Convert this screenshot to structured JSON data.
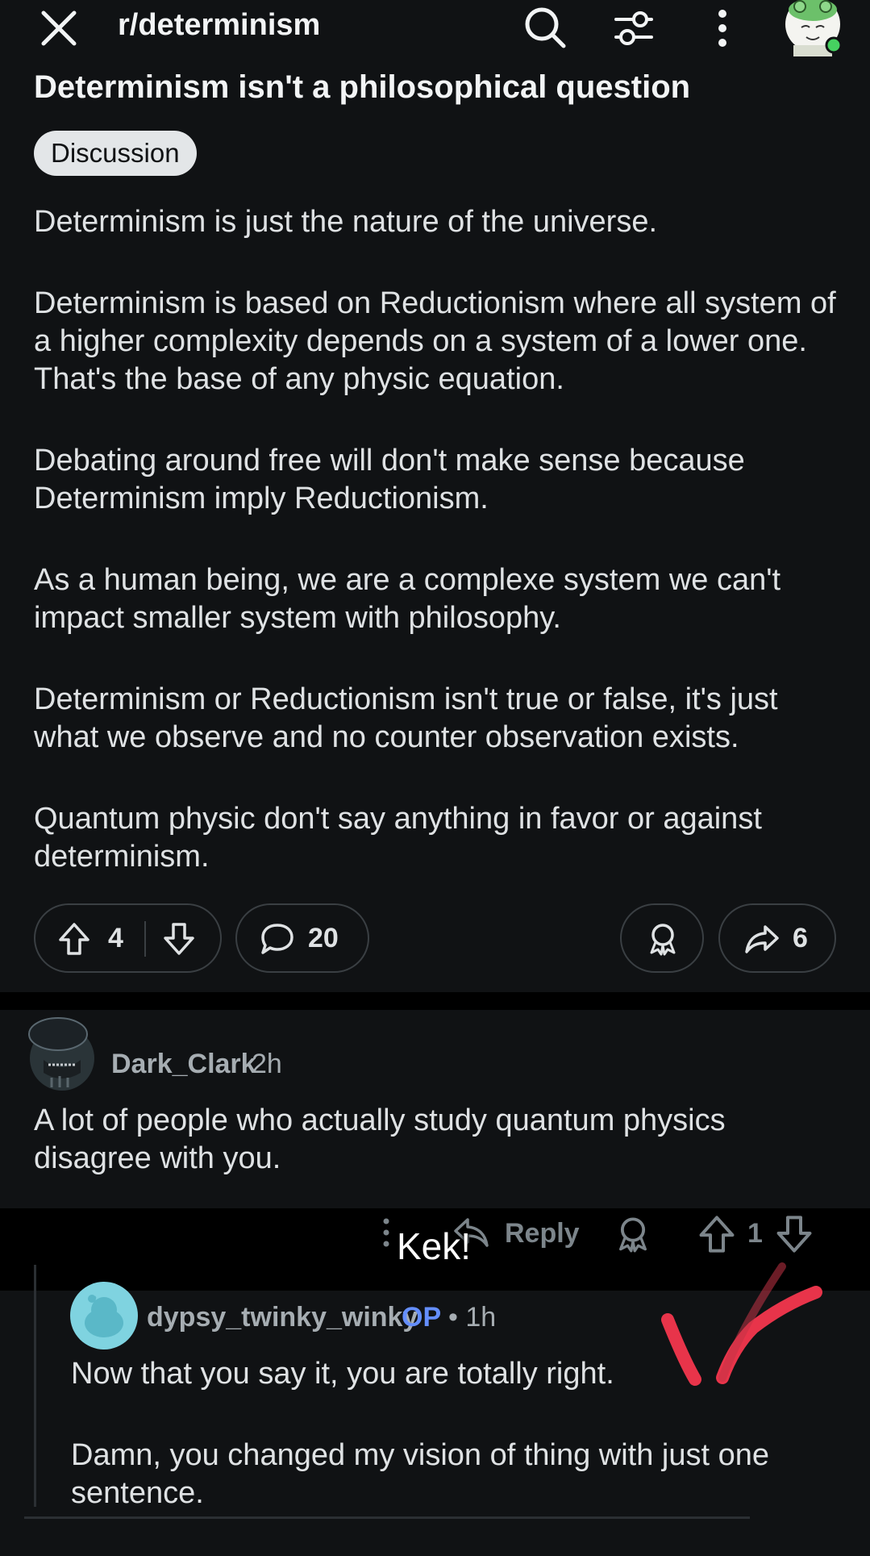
{
  "topbar": {
    "subreddit": "r/determinism",
    "icons": [
      "close-icon",
      "search-icon",
      "filter-icon",
      "more-icon",
      "avatar"
    ]
  },
  "post": {
    "title": "Determinism isn't a philosophical question",
    "flair": "Discussion",
    "paragraphs": [
      "Determinism is just the nature of the universe.",
      "Determinism is based on Reductionism where all system of a higher complexity depends on a system of a lower one. That's the base of any physic equation.",
      "Debating around free will don't make sense because Determinism imply Reductionism.",
      "As a human being, we are a complexe system we can't impact smaller system with philosophy.",
      "Determinism or Reductionism isn't true or false, it's just what we observe and no counter observation exists.",
      "Quantum physic don't say anything in favor or against determinism."
    ],
    "votes": "4",
    "comments": "20",
    "shares": "6"
  },
  "comment": {
    "user": "Dark_Clark",
    "time": "2h",
    "body": "A lot of people who actually study quantum physics disagree with you.",
    "reply_label": "Reply",
    "votes": "1",
    "overlay_text": "Kek!"
  },
  "reply": {
    "user": "dypsy_twinky_winky",
    "op_badge": "OP",
    "time": "• 1h",
    "paragraphs": [
      "Now that you say it, you are totally right.",
      "Damn, you changed my vision of thing with just one sentence."
    ]
  },
  "colors": {
    "background": "#101214",
    "op_blue": "#648efc",
    "annotation_red": "#e8344a"
  }
}
